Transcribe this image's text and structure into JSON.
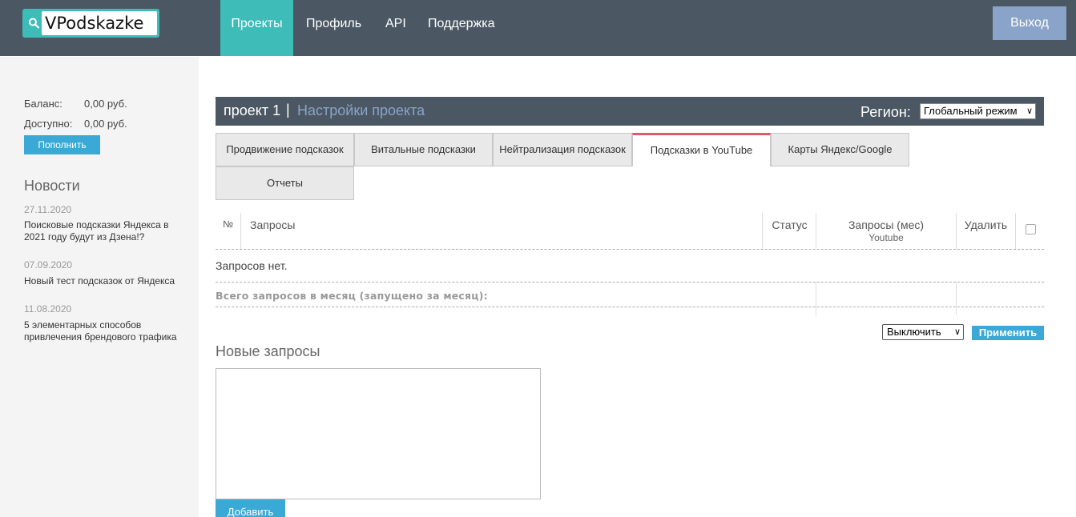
{
  "header": {
    "logo_text": "VPodskazke",
    "nav": [
      "Проекты",
      "Профиль",
      "API",
      "Поддержка"
    ],
    "logout": "Выход",
    "accent": "#3ebcb8"
  },
  "sidebar": {
    "balance_label": "Баланс:",
    "balance_value": "0,00 руб.",
    "available_label": "Доступно:",
    "available_value": "0,00 руб.",
    "topup": "Пополнить",
    "news_title": "Новости",
    "news": [
      {
        "date": "27.11.2020",
        "text": "Поисковые подсказки Яндекса в 2021 году будут из Дзена!?"
      },
      {
        "date": "07.09.2020",
        "text": "Новый тест подсказок от Яндекса"
      },
      {
        "date": "11.08.2020",
        "text": "5 элементарных способов привлечения брендового трафика"
      }
    ]
  },
  "project": {
    "name": "проект 1",
    "separator": "|",
    "settings": "Настройки проекта",
    "region_label": "Регион:",
    "region_value": "Глобальный режим"
  },
  "tabs": [
    "Продвижение подсказок",
    "Витальные подсказки",
    "Нейтрализация подсказок",
    "Подсказки в YouTube",
    "Карты Яндекс/Google",
    "Отчеты"
  ],
  "table": {
    "col_num": "№",
    "col_queries": "Запросы",
    "col_status": "Статус",
    "col_month": "Запросы (мес)",
    "col_month_sub": "Youtube",
    "col_delete": "Удалить",
    "empty": "Запросов нет.",
    "total": "Всего запросов в месяц (запущено за месяц):"
  },
  "actions": {
    "select_value": "Выключить",
    "apply": "Применить"
  },
  "new_queries": {
    "title": "Новые запросы",
    "textarea_value": "",
    "add": "Добавить"
  }
}
